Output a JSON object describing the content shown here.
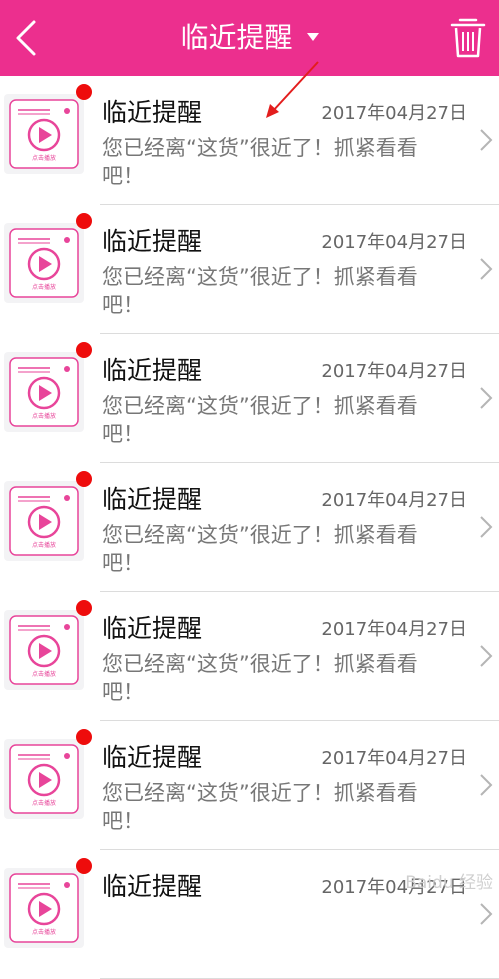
{
  "header": {
    "title": "临近提醒",
    "colors": {
      "bar": "#ec2f8e",
      "text": "#ffffff"
    }
  },
  "notifications": [
    {
      "title": "临近提醒",
      "date": "2017年04月27日",
      "body": "您已经离“这货”很近了！抓紧看看吧！",
      "unread": true
    },
    {
      "title": "临近提醒",
      "date": "2017年04月27日",
      "body": "您已经离“这货”很近了！抓紧看看吧！",
      "unread": true
    },
    {
      "title": "临近提醒",
      "date": "2017年04月27日",
      "body": "您已经离“这货”很近了！抓紧看看吧！",
      "unread": true
    },
    {
      "title": "临近提醒",
      "date": "2017年04月27日",
      "body": "您已经离“这货”很近了！抓紧看看吧！",
      "unread": true
    },
    {
      "title": "临近提醒",
      "date": "2017年04月27日",
      "body": "您已经离“这货”很近了！抓紧看看吧！",
      "unread": true
    },
    {
      "title": "临近提醒",
      "date": "2017年04月27日",
      "body": "您已经离“这货”很近了！抓紧看看吧！",
      "unread": true
    },
    {
      "title": "临近提醒",
      "date": "2017年04月27日",
      "body": "",
      "unread": true
    }
  ],
  "thumbnail": {
    "caption": "点击播放",
    "icon": "video-play-icon",
    "accent": "#e8459a"
  },
  "unread_dot_color": "#ee0c0c",
  "watermark": "Baidu 经验"
}
